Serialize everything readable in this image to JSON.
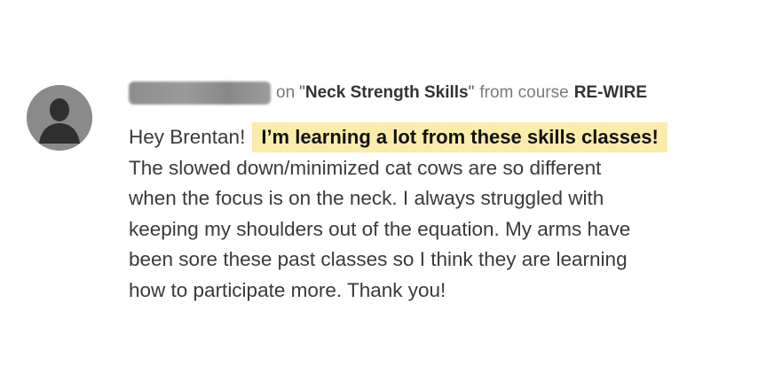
{
  "comment": {
    "author_redacted": true,
    "meta": {
      "on_label": "on",
      "quote_open": "\"",
      "lesson_title": "Neck Strength Skills",
      "quote_close": "\"",
      "from_label": "from course",
      "course_name": "RE-WIRE"
    },
    "body": {
      "greeting": "Hey Brentan!",
      "highlight": "I’m learning a lot from these skills classes!",
      "lines": [
        "The slowed down/minimized cat cows are so different",
        "when the focus is on the neck. I always struggled with",
        "keeping my shoulders out of the equation. My arms have",
        "been sore these past classes so I think they are learning",
        "how to participate more. Thank you!"
      ]
    },
    "colors": {
      "highlight_background": "#fbecab",
      "avatar_background": "#8a8a8a"
    },
    "icons": {
      "avatar": "default-user-silhouette-icon"
    }
  }
}
